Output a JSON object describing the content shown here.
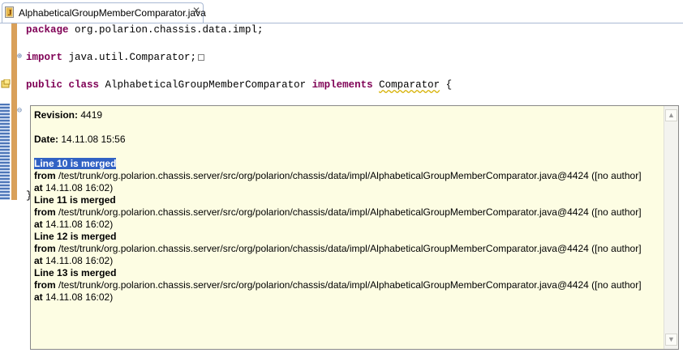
{
  "tab": {
    "label": "AlphabeticalGroupMemberComparator.java",
    "close_glyph": "✕"
  },
  "code": {
    "line1_kw": "package",
    "line1_rest": " org.polarion.chassis.data.impl;",
    "line2_kw": "import",
    "line2_rest": " java.util.Comparator;",
    "line3_kw1": "public",
    "line3_kw2": "class",
    "line3_name": " AlphabeticalGroupMemberComparator ",
    "line3_kw3": "implements",
    "line3_iface": "Comparator",
    "line3_end": " {",
    "closing": "}"
  },
  "popup": {
    "revision_label": "Revision:",
    "revision_value": " 4419",
    "date_label": "Date:",
    "date_value": " 14.11.08 15:56",
    "entries": [
      {
        "line_prefix": "Line ",
        "line_num": "10",
        "merged": " is merged",
        "from_label": "from",
        "path": " /test/trunk/org.polarion.chassis.server/src/org/polarion/chassis/data/impl/AlphabeticalGroupMemberComparator.java@4424 ([no author]",
        "at_label": "at",
        "at_value": " 14.11.08 16:02)"
      },
      {
        "line_prefix": "Line ",
        "line_num": "11",
        "merged": " is merged",
        "from_label": "from",
        "path": " /test/trunk/org.polarion.chassis.server/src/org/polarion/chassis/data/impl/AlphabeticalGroupMemberComparator.java@4424 ([no author]",
        "at_label": "at",
        "at_value": " 14.11.08 16:02)"
      },
      {
        "line_prefix": "Line ",
        "line_num": "12",
        "merged": " is merged",
        "from_label": "from",
        "path": " /test/trunk/org.polarion.chassis.server/src/org/polarion/chassis/data/impl/AlphabeticalGroupMemberComparator.java@4424 ([no author]",
        "at_label": "at",
        "at_value": " 14.11.08 16:02)"
      },
      {
        "line_prefix": "Line ",
        "line_num": "13",
        "merged": " is merged",
        "from_label": "from",
        "path": " /test/trunk/org.polarion.chassis.server/src/org/polarion/chassis/data/impl/AlphabeticalGroupMemberComparator.java@4424 ([no author]",
        "at_label": "at",
        "at_value": " 14.11.08 16:02)"
      }
    ]
  },
  "icons": {
    "tab_file_icon": "java-file-icon",
    "fold_expand": "fold-expand-icon",
    "fold_collapse": "fold-collapse-icon",
    "warning": "warning-icon"
  },
  "colors": {
    "keyword": "#7f0055",
    "popup_bg": "#fdfde3",
    "selection": "#3162c4",
    "change_bar": "#d9a05a"
  }
}
